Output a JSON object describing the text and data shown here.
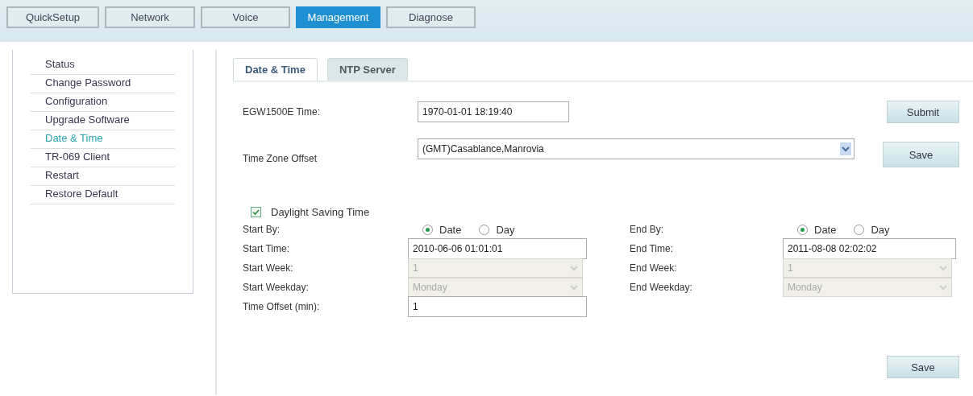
{
  "nav_tabs": [
    {
      "label": "QuickSetup",
      "selected": false
    },
    {
      "label": "Network",
      "selected": false
    },
    {
      "label": "Voice",
      "selected": false
    },
    {
      "label": "Management",
      "selected": true
    },
    {
      "label": "Diagnose",
      "selected": false
    }
  ],
  "sidebar": {
    "items": [
      {
        "label": "Status",
        "selected": false
      },
      {
        "label": "Change Password",
        "selected": false
      },
      {
        "label": "Configuration",
        "selected": false
      },
      {
        "label": "Upgrade Software",
        "selected": false
      },
      {
        "label": "Date & Time",
        "selected": true
      },
      {
        "label": "TR-069 Client",
        "selected": false
      },
      {
        "label": "Restart",
        "selected": false
      },
      {
        "label": "Restore Default",
        "selected": false
      }
    ]
  },
  "tabs": [
    {
      "label": "Date & Time",
      "selected": true
    },
    {
      "label": "NTP Server",
      "selected": false
    }
  ],
  "device_time": {
    "label": "EGW1500E Time:",
    "value": "1970-01-01 18:19:40",
    "button": "Submit"
  },
  "time_zone": {
    "label": "Time Zone Offset",
    "value": "(GMT)Casablance,Manrovia",
    "button": "Save"
  },
  "daylight_saving": {
    "label": "Daylight Saving Time",
    "checked": true
  },
  "rows": [
    {
      "left": {
        "kind": "radio",
        "label": "Start By:",
        "options": [
          {
            "label": "Date",
            "selected": true
          },
          {
            "label": "Day",
            "selected": false
          }
        ]
      },
      "right": {
        "kind": "radio",
        "label": "End By:",
        "options": [
          {
            "label": "Date",
            "selected": true
          },
          {
            "label": "Day",
            "selected": false
          }
        ]
      }
    },
    {
      "left": {
        "kind": "text",
        "label": "Start Time:",
        "value": "2010-06-06 01:01:01"
      },
      "right": {
        "kind": "text",
        "label": "End Time:",
        "value": "2011-08-08 02:02:02"
      }
    },
    {
      "left": {
        "kind": "select",
        "label": "Start Week:",
        "value": "1",
        "disabled": true
      },
      "right": {
        "kind": "select",
        "label": "End Week:",
        "value": "1",
        "disabled": true
      }
    },
    {
      "left": {
        "kind": "select",
        "label": "Start Weekday:",
        "value": "Monday",
        "disabled": true
      },
      "right": {
        "kind": "select",
        "label": "End Weekday:",
        "value": "Monday",
        "disabled": true
      }
    },
    {
      "left": {
        "kind": "text",
        "label": "Time Offset (min):",
        "value": "1"
      }
    }
  ],
  "save_button": "Save"
}
